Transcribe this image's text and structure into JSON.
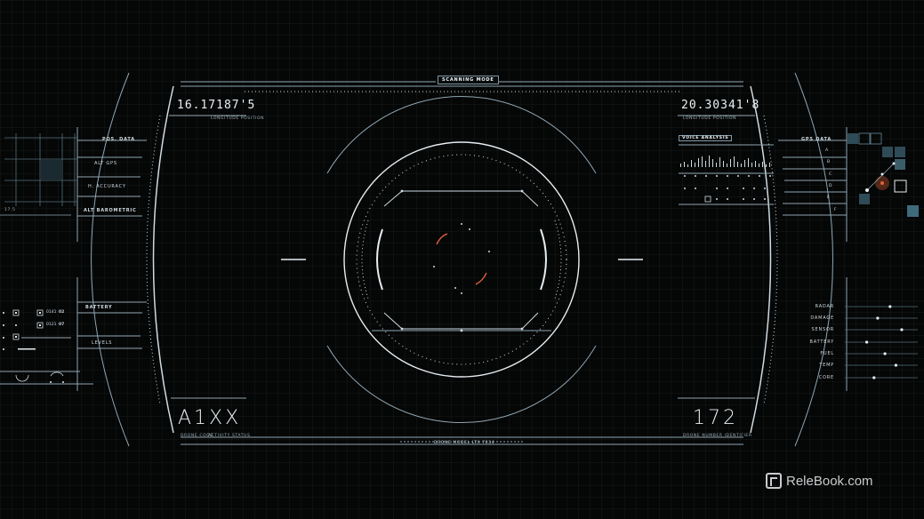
{
  "header": {
    "mode_label": "SCANNING MODE"
  },
  "coordinates": {
    "left": {
      "value": "16.17187'5",
      "caption": "LONGITUDE POSITION"
    },
    "right": {
      "value": "20.30341'8",
      "caption": "LONGITUDE POSITION"
    }
  },
  "left_panel": {
    "labels": [
      "POS. DATA",
      "ALT GPS",
      "H. ACCURACY",
      "ALT BAROMETRIC"
    ],
    "small_value": "17.5",
    "lower_labels": [
      "BATTERY",
      "LEVELS"
    ],
    "readouts": [
      "0141",
      "02",
      "0121",
      "07"
    ]
  },
  "right_panel": {
    "voice_label": "VOICE ANALYSIS",
    "gps_label": "GPS DATA",
    "gps_letters": [
      "A",
      "B",
      "C",
      "D",
      "E",
      "F"
    ],
    "systems": [
      "RADAR",
      "DAMAGE",
      "SENSOR",
      "BATTERY",
      "FUEL",
      "TEMP",
      "CORE"
    ],
    "system_levels": [
      0.62,
      0.45,
      0.78,
      0.3,
      0.55,
      0.7,
      0.4
    ]
  },
  "bottom": {
    "drone_code": "A1XX",
    "drone_code_captions": [
      "DRONE CODE",
      "ACTIVITY STATUS"
    ],
    "drone_number": "172",
    "drone_number_caption": "DRONE NUMBER IDENTIFIER",
    "model_caption": "DRONE MODEL LTX 7034"
  },
  "watermark": {
    "text": "ReleBook.com"
  },
  "colors": {
    "accent": "#e0633a",
    "line": "#8fa6b1",
    "bright": "#e6eef2",
    "panel": "#2e4b57"
  }
}
